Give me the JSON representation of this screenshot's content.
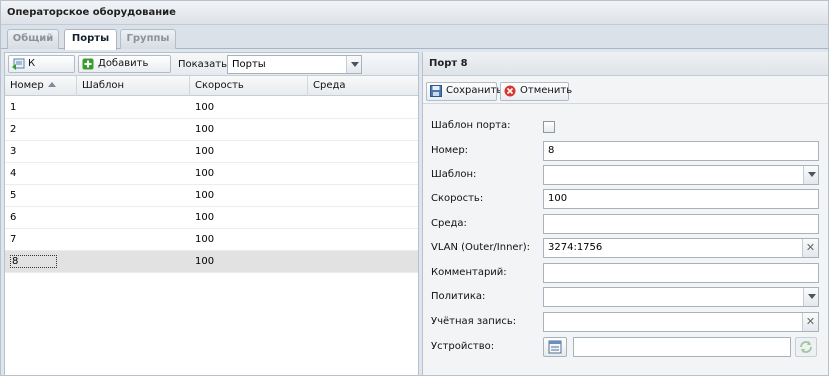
{
  "window": {
    "title": "Операторское оборудование"
  },
  "tabs": [
    {
      "label": "Общий",
      "active": false
    },
    {
      "label": "Порты",
      "active": true
    },
    {
      "label": "Группы",
      "active": false
    }
  ],
  "left_toolbar": {
    "back_label": "К списку",
    "add_label": "Добавить порт",
    "show_label": "Показать:",
    "show_value": "Порты"
  },
  "grid": {
    "columns": [
      "Номер",
      "Шаблон",
      "Скорость",
      "Среда"
    ],
    "sort": {
      "column": "Номер",
      "direction": "asc"
    },
    "rows": [
      {
        "number": "1",
        "template": "",
        "speed": "100",
        "medium": ""
      },
      {
        "number": "2",
        "template": "",
        "speed": "100",
        "medium": ""
      },
      {
        "number": "3",
        "template": "",
        "speed": "100",
        "medium": ""
      },
      {
        "number": "4",
        "template": "",
        "speed": "100",
        "medium": ""
      },
      {
        "number": "5",
        "template": "",
        "speed": "100",
        "medium": ""
      },
      {
        "number": "6",
        "template": "",
        "speed": "100",
        "medium": ""
      },
      {
        "number": "7",
        "template": "",
        "speed": "100",
        "medium": ""
      },
      {
        "number": "8",
        "template": "",
        "speed": "100",
        "medium": ""
      }
    ],
    "selected_row": 7
  },
  "detail": {
    "title": "Порт 8",
    "save_label": "Сохранить",
    "cancel_label": "Отменить",
    "fields": {
      "port_template": {
        "label": "Шаблон порта:",
        "checked": false
      },
      "number": {
        "label": "Номер:",
        "value": "8"
      },
      "template": {
        "label": "Шаблон:",
        "value": ""
      },
      "speed": {
        "label": "Скорость:",
        "value": "100"
      },
      "medium": {
        "label": "Среда:",
        "value": ""
      },
      "vlan": {
        "label": "VLAN (Outer/Inner):",
        "value": "3274:1756"
      },
      "comment": {
        "label": "Комментарий:",
        "value": ""
      },
      "policy": {
        "label": "Политика:",
        "value": ""
      },
      "account": {
        "label": "Учётная запись:",
        "value": ""
      },
      "device": {
        "label": "Устройство:",
        "value": ""
      }
    }
  },
  "colors": {
    "header_bg": "#dde2e8",
    "selected_row_bg": "#e2e2e2",
    "cancel_icon": "#d9352f",
    "add_icon": "#3a9b2e"
  }
}
